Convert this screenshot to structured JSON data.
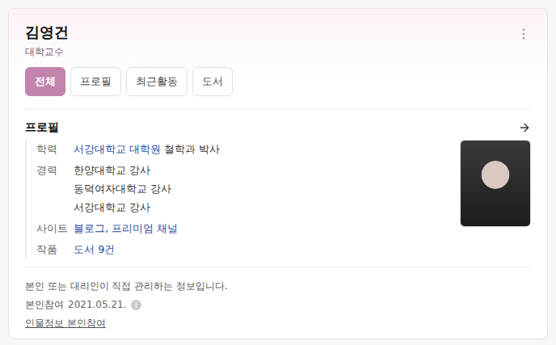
{
  "person": {
    "name": "김영건",
    "title": "대학교수"
  },
  "tabs": [
    {
      "label": "전체",
      "selected": true
    },
    {
      "label": "프로필",
      "selected": false
    },
    {
      "label": "최근활동",
      "selected": false
    },
    {
      "label": "도서",
      "selected": false
    }
  ],
  "profile": {
    "heading": "프로필",
    "rows": [
      {
        "label": "학력",
        "lines": [
          [
            {
              "text": "서강대학교 대학원",
              "link": true
            },
            {
              "text": "철학과 박사",
              "link": false
            }
          ]
        ]
      },
      {
        "label": "경력",
        "lines": [
          [
            {
              "text": "한양대학교 강사",
              "link": false
            }
          ],
          [
            {
              "text": "동덕여자대학교 강사",
              "link": false
            }
          ],
          [
            {
              "text": "서강대학교 강사",
              "link": false
            }
          ]
        ]
      },
      {
        "label": "사이트",
        "lines": [
          [
            {
              "text": "블로그, 프리미엄 채널",
              "link": true
            }
          ]
        ]
      },
      {
        "label": "작품",
        "lines": [
          [
            {
              "text": "도서 9건",
              "link": true
            }
          ]
        ]
      }
    ]
  },
  "footer": {
    "notice": "본인 또는 대리인이 직접 관리하는 정보입니다.",
    "participation_label": "본인참여",
    "participation_date": "2021.05.21.",
    "link": "인물정보 본인참여"
  }
}
